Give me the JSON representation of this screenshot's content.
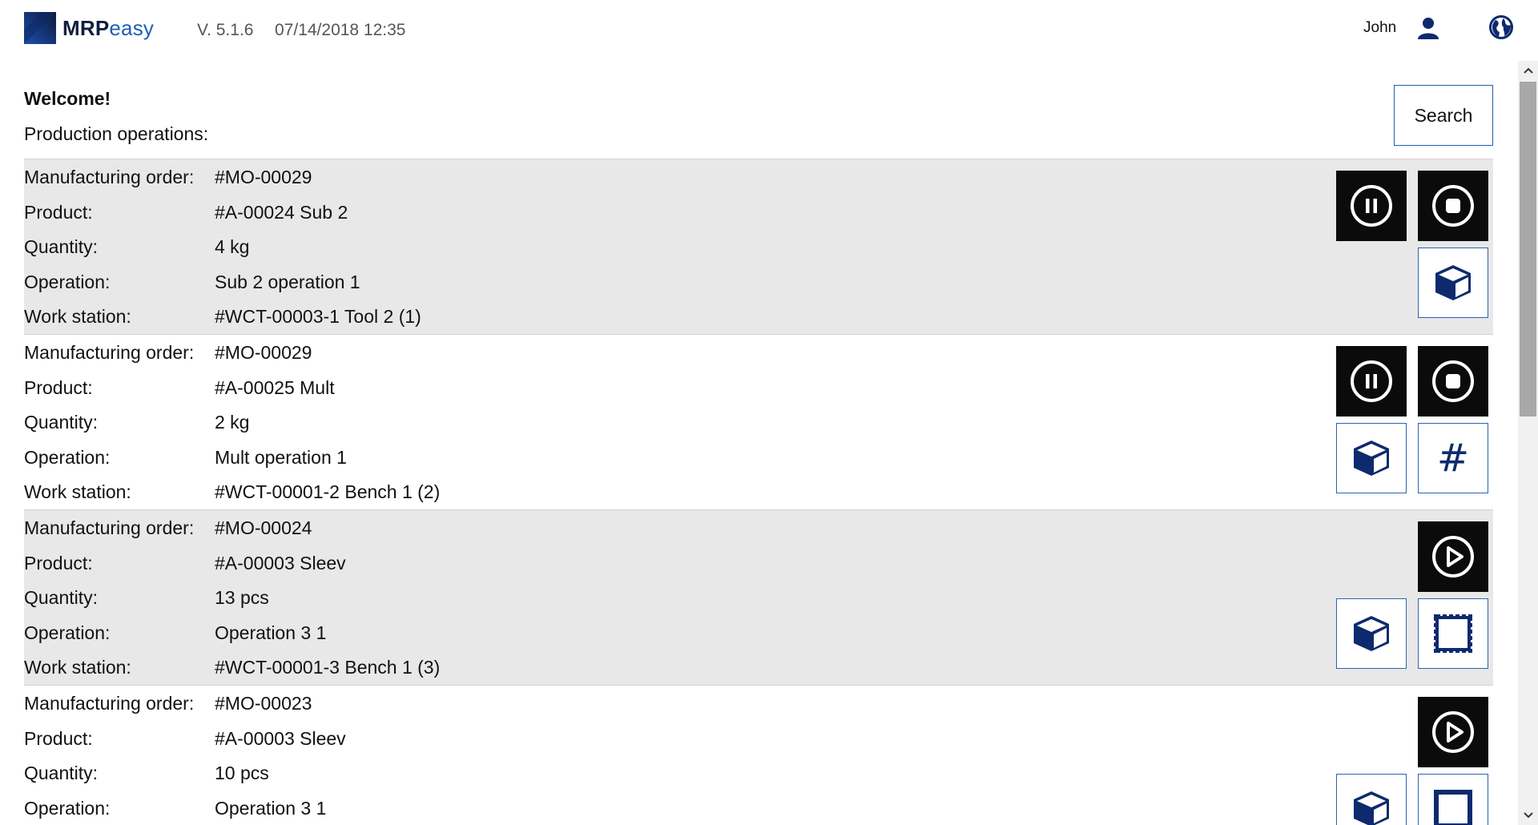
{
  "header": {
    "brand_bold": "MRP",
    "brand_light": "easy",
    "version": "V. 5.1.6",
    "datetime": "07/14/2018 12:35",
    "user_name": "John",
    "colors": {
      "brand_dark": "#0f1f3d",
      "brand_blue": "#1f5fb8",
      "accent": "#0e2a6e"
    }
  },
  "main": {
    "welcome": "Welcome!",
    "subtitle": "Production operations:",
    "search_label": "Search"
  },
  "labels": {
    "mo": "Manufacturing order:",
    "product": "Product:",
    "quantity": "Quantity:",
    "operation": "Operation:",
    "workstation": "Work station:"
  },
  "operations": [
    {
      "mo": "#MO-00029",
      "product": "#A-00024 Sub 2",
      "quantity": "4 kg",
      "operation": "Sub 2 operation 1",
      "workstation": "#WCT-00003-1 Tool 2 (1)",
      "state": "running",
      "actions": [
        "pause-icon",
        "stop-icon",
        "box-icon"
      ]
    },
    {
      "mo": "#MO-00029",
      "product": "#A-00025 Mult",
      "quantity": "2 kg",
      "operation": "Mult operation 1",
      "workstation": "#WCT-00001-2 Bench 1 (2)",
      "state": "running",
      "actions": [
        "pause-icon",
        "stop-icon",
        "box-icon",
        "hash-icon"
      ]
    },
    {
      "mo": "#MO-00024",
      "product": "#A-00003 Sleev",
      "quantity": "13 pcs",
      "operation": "Operation 3 1",
      "workstation": "#WCT-00001-3 Bench 1 (3)",
      "state": "paused",
      "actions": [
        "play-icon",
        "box-icon",
        "frame-icon"
      ]
    },
    {
      "mo": "#MO-00023",
      "product": "#A-00003 Sleev",
      "quantity": "10 pcs",
      "operation": "Operation 3 1",
      "workstation": "",
      "state": "paused",
      "actions": [
        "play-icon",
        "box-icon",
        "frame-icon"
      ]
    }
  ],
  "hash_symbol": "#"
}
